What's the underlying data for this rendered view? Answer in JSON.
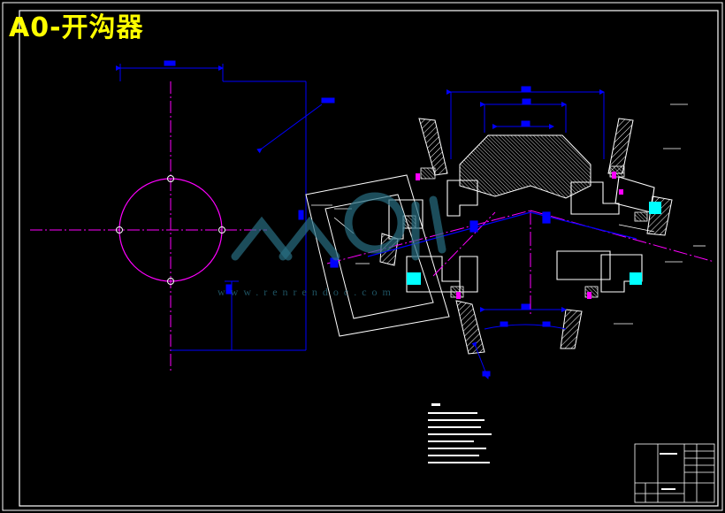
{
  "title": "A0-开沟器",
  "watermark": {
    "url_text": "www.renrendoc.com"
  },
  "colors": {
    "background": "#000000",
    "border": "#ffffff",
    "title": "#ffff00",
    "dimension": "#0000ff",
    "centerline": "#ff00ff",
    "geometry": "#ffffff",
    "hatch": "#ffffff",
    "highlight": "#00ffff",
    "watermark": "#2a6e82"
  },
  "icons": {
    "watermark_logo": "renrendoc-logo-icon"
  }
}
